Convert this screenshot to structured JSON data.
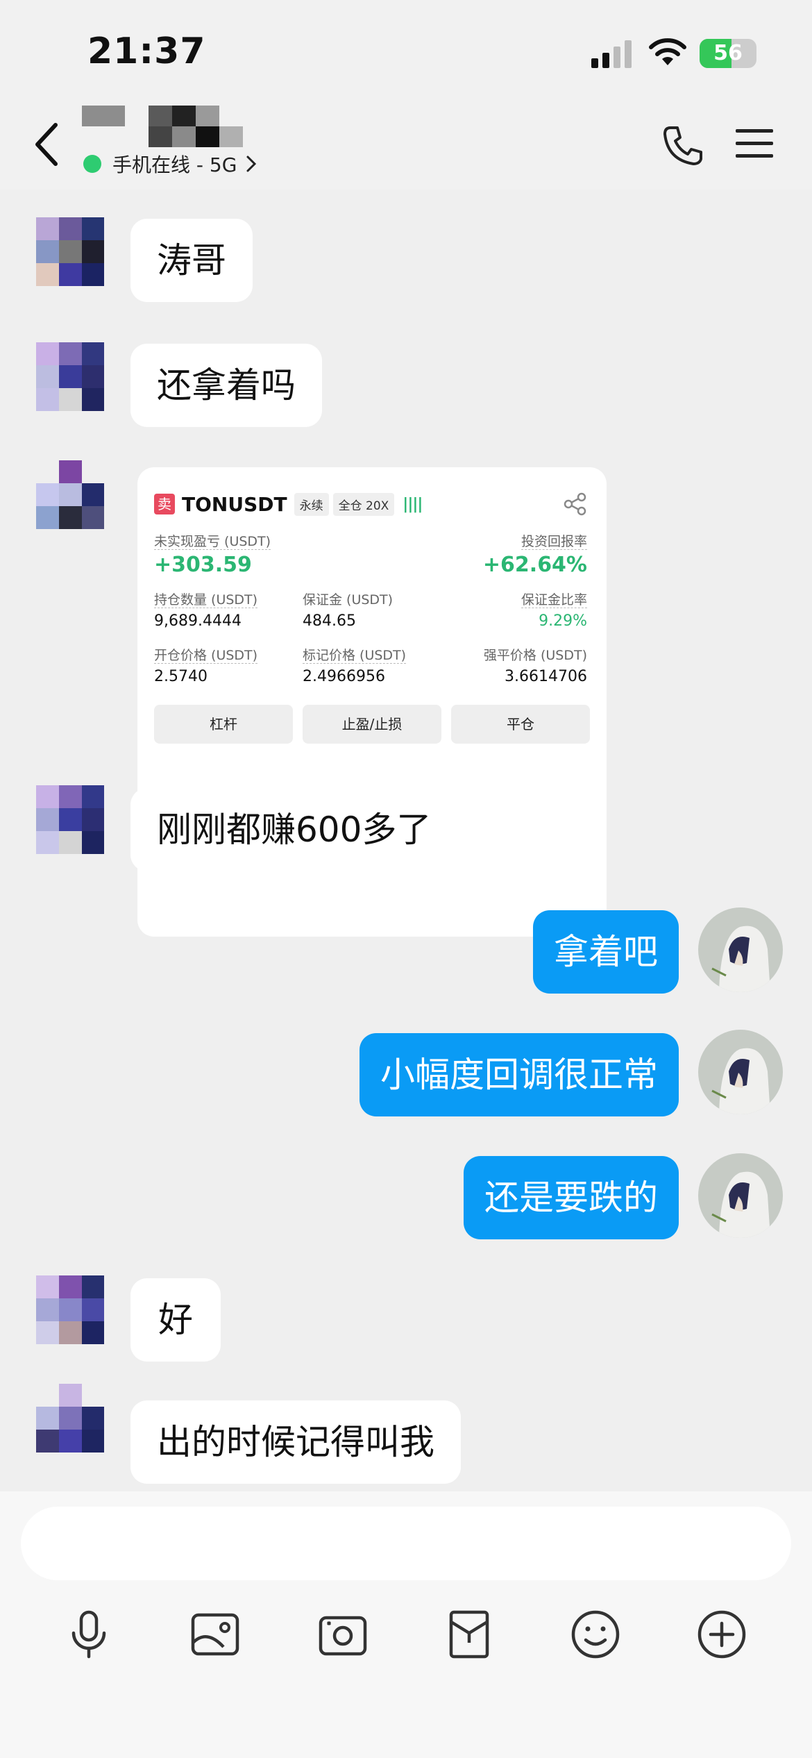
{
  "status_bar": {
    "time": "21:37",
    "battery": "56",
    "battery_level": 0.56
  },
  "header": {
    "online_status": "手机在线 - 5G"
  },
  "messages": [
    {
      "side": "left",
      "text": "涛哥"
    },
    {
      "side": "left",
      "text": "还拿着吗"
    },
    {
      "side": "left",
      "text": "刚刚都赚600多了"
    },
    {
      "side": "right",
      "text": "拿着吧"
    },
    {
      "side": "right",
      "text": "小幅度回调很正常"
    },
    {
      "side": "right",
      "text": "还是要跌的"
    },
    {
      "side": "left",
      "text": "好"
    },
    {
      "side": "left",
      "text": "出的时候记得叫我"
    }
  ],
  "trade_card": {
    "sell_tag": "卖",
    "pair": "TONUSDT",
    "tag_perpetual": "永续",
    "tag_margin": "全仓 20X",
    "leverage_bars": "||||",
    "unrealized_pnl_label": "未实现盈亏 (USDT)",
    "unrealized_pnl": "+303.59",
    "roi_label": "投资回报率",
    "roi": "+62.64%",
    "position_size_label": "持仓数量 (USDT)",
    "position_size": "9,689.4444",
    "margin_label": "保证金 (USDT)",
    "margin": "484.65",
    "margin_ratio_label": "保证金比率",
    "margin_ratio": "9.29%",
    "entry_price_label": "开仓价格 (USDT)",
    "entry_price": "2.5740",
    "mark_price_label": "标记价格 (USDT)",
    "mark_price": "2.4966956",
    "liq_price_label": "强平价格 (USDT)",
    "liq_price": "3.6614706",
    "btn_leverage": "杠杆",
    "btn_tpsl": "止盈/止损",
    "btn_close": "平仓"
  },
  "composer": {
    "placeholder": ""
  },
  "icons": {
    "toolbar": [
      "microphone-icon",
      "image-icon",
      "camera-icon",
      "red-packet-icon",
      "emoji-icon",
      "plus-icon"
    ],
    "header": [
      "back-chevron-icon",
      "phone-icon",
      "menu-icon"
    ]
  },
  "colors": {
    "my_bubble": "#0a9bf5",
    "profit_green": "#2bb673",
    "online_green": "#2ecc71",
    "sell_red": "#e84a5f"
  }
}
